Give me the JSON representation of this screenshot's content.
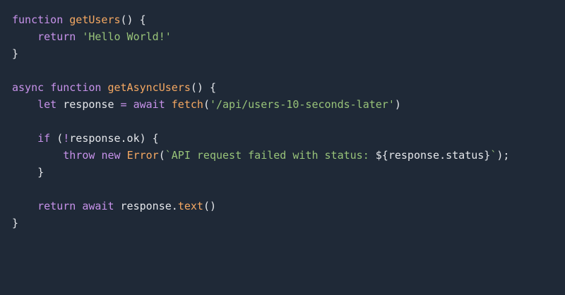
{
  "colors": {
    "background": "#1f2937",
    "keyword": "#c792ea",
    "function_name": "#f5a862",
    "string": "#98c379",
    "plain": "#e5e7eb"
  },
  "code": {
    "lines": [
      [
        {
          "t": "kw",
          "v": "function"
        },
        {
          "t": "plain",
          "v": " "
        },
        {
          "t": "fn",
          "v": "getUsers"
        },
        {
          "t": "plain",
          "v": "() {"
        }
      ],
      [
        {
          "t": "plain",
          "v": "    "
        },
        {
          "t": "kw",
          "v": "return"
        },
        {
          "t": "plain",
          "v": " "
        },
        {
          "t": "str",
          "v": "'Hello World!'"
        }
      ],
      [
        {
          "t": "plain",
          "v": "}"
        }
      ],
      [],
      [
        {
          "t": "kw",
          "v": "async"
        },
        {
          "t": "plain",
          "v": " "
        },
        {
          "t": "kw",
          "v": "function"
        },
        {
          "t": "plain",
          "v": " "
        },
        {
          "t": "fn",
          "v": "getAsyncUsers"
        },
        {
          "t": "plain",
          "v": "() {"
        }
      ],
      [
        {
          "t": "plain",
          "v": "    "
        },
        {
          "t": "kw",
          "v": "let"
        },
        {
          "t": "plain",
          "v": " response "
        },
        {
          "t": "op",
          "v": "="
        },
        {
          "t": "plain",
          "v": " "
        },
        {
          "t": "kw",
          "v": "await"
        },
        {
          "t": "plain",
          "v": " "
        },
        {
          "t": "fn",
          "v": "fetch"
        },
        {
          "t": "plain",
          "v": "("
        },
        {
          "t": "str",
          "v": "'/api/users-10-seconds-later'"
        },
        {
          "t": "plain",
          "v": ")"
        }
      ],
      [],
      [
        {
          "t": "plain",
          "v": "    "
        },
        {
          "t": "kw",
          "v": "if"
        },
        {
          "t": "plain",
          "v": " ("
        },
        {
          "t": "op",
          "v": "!"
        },
        {
          "t": "plain",
          "v": "response.ok) {"
        }
      ],
      [
        {
          "t": "plain",
          "v": "        "
        },
        {
          "t": "kw",
          "v": "throw"
        },
        {
          "t": "plain",
          "v": " "
        },
        {
          "t": "kw",
          "v": "new"
        },
        {
          "t": "plain",
          "v": " "
        },
        {
          "t": "fn",
          "v": "Error"
        },
        {
          "t": "plain",
          "v": "("
        },
        {
          "t": "str",
          "v": "`API request failed with status: "
        },
        {
          "t": "plain",
          "v": "${response.status}"
        },
        {
          "t": "str",
          "v": "`"
        },
        {
          "t": "plain",
          "v": ");"
        }
      ],
      [
        {
          "t": "plain",
          "v": "    }"
        }
      ],
      [],
      [
        {
          "t": "plain",
          "v": "    "
        },
        {
          "t": "kw",
          "v": "return"
        },
        {
          "t": "plain",
          "v": " "
        },
        {
          "t": "kw",
          "v": "await"
        },
        {
          "t": "plain",
          "v": " response."
        },
        {
          "t": "fn",
          "v": "text"
        },
        {
          "t": "plain",
          "v": "()"
        }
      ],
      [
        {
          "t": "plain",
          "v": "}"
        }
      ]
    ]
  }
}
